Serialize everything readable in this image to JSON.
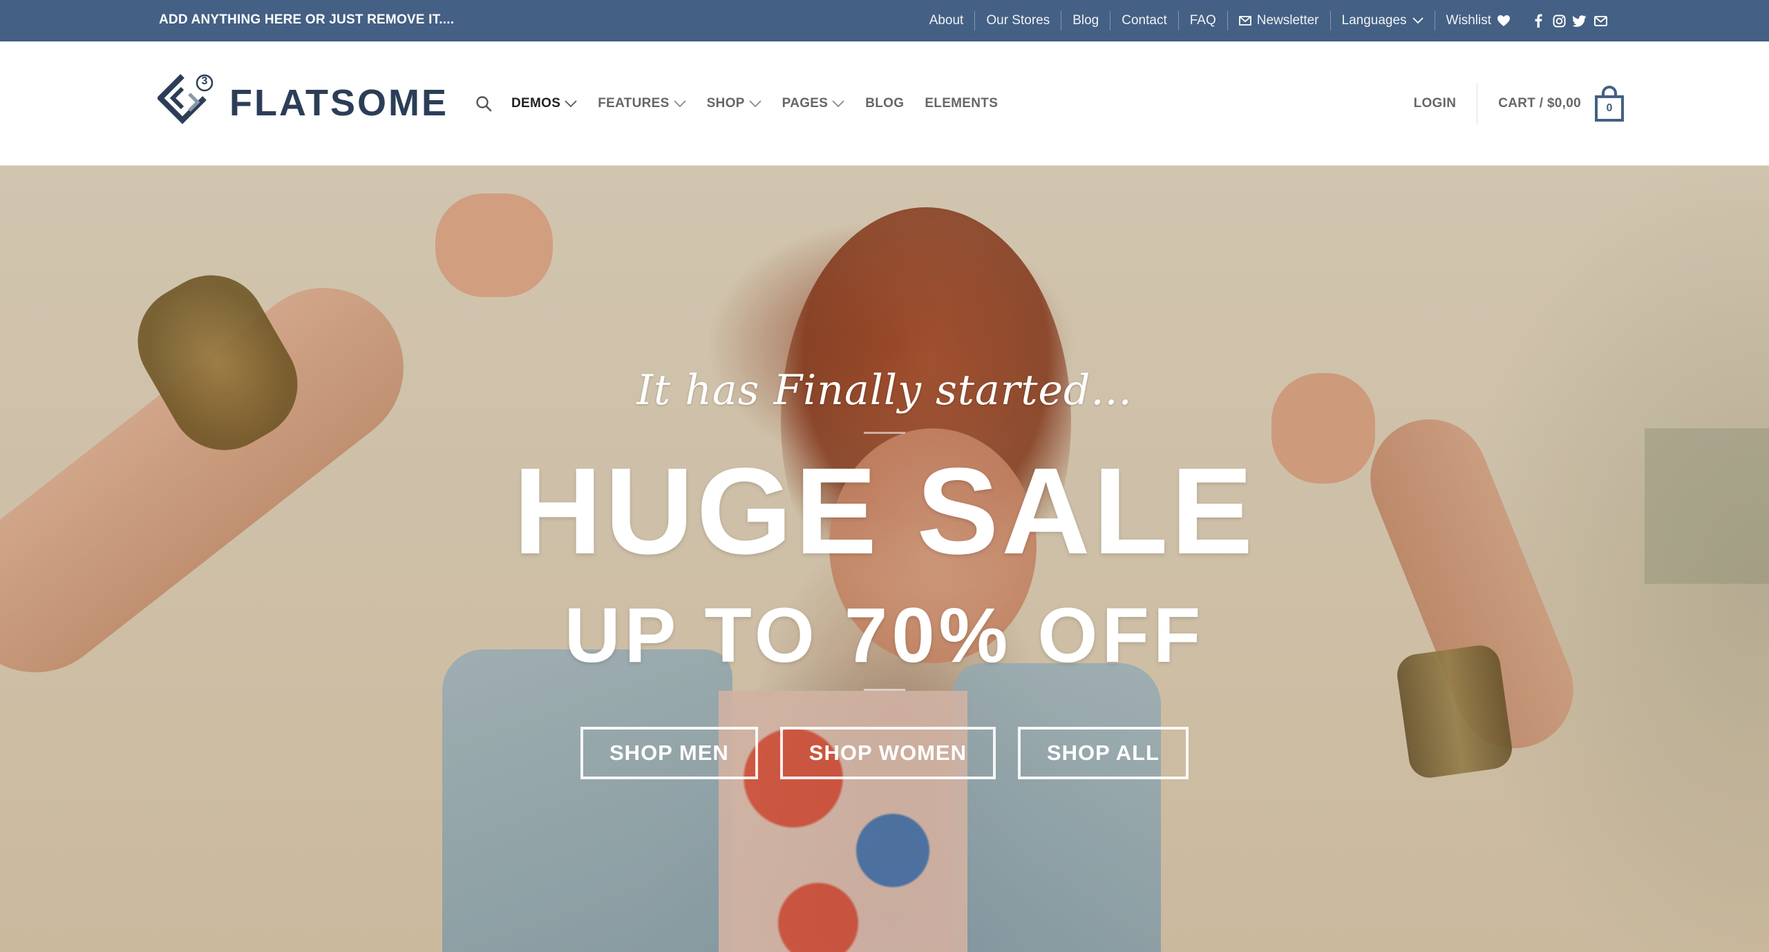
{
  "topbar": {
    "promo": "ADD ANYTHING HERE OR JUST REMOVE IT....",
    "links": [
      {
        "label": "About"
      },
      {
        "label": "Our Stores"
      },
      {
        "label": "Blog"
      },
      {
        "label": "Contact"
      },
      {
        "label": "FAQ"
      },
      {
        "label": "Newsletter",
        "icon": "envelope-icon"
      },
      {
        "label": "Languages",
        "icon": "chevron-down-icon"
      },
      {
        "label": "Wishlist",
        "icon": "heart-icon"
      }
    ],
    "social": [
      "facebook-icon",
      "instagram-icon",
      "twitter-icon",
      "email-icon"
    ],
    "bg_color": "#446084"
  },
  "header": {
    "logo_text": "FLATSOME",
    "logo_badge": "3",
    "nav": [
      {
        "label": "DEMOS",
        "dropdown": true,
        "active": true
      },
      {
        "label": "FEATURES",
        "dropdown": true
      },
      {
        "label": "SHOP",
        "dropdown": true
      },
      {
        "label": "PAGES",
        "dropdown": true
      },
      {
        "label": "BLOG",
        "dropdown": false
      },
      {
        "label": "ELEMENTS",
        "dropdown": false
      }
    ],
    "login": "LOGIN",
    "cart_label": "CART / $0,00",
    "cart_count": "0"
  },
  "hero": {
    "script": "It has Finally started...",
    "title": "HUGE SALE",
    "subtitle": "UP TO 70% OFF",
    "buttons": [
      {
        "label": "SHOP MEN"
      },
      {
        "label": "SHOP WOMEN"
      },
      {
        "label": "SHOP ALL"
      }
    ]
  }
}
